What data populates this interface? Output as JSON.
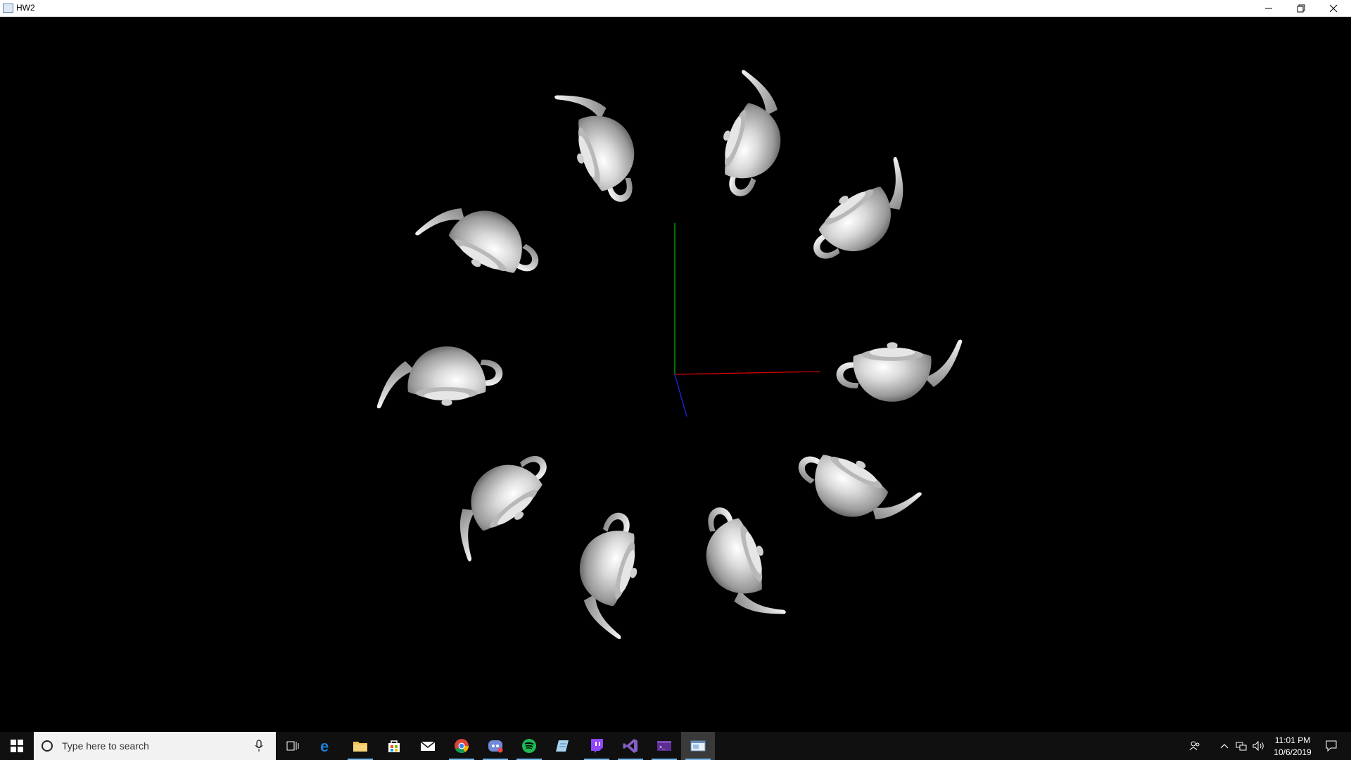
{
  "window": {
    "title": "HW2"
  },
  "colors": {
    "axis_x": "#e00000",
    "axis_y": "#00c000",
    "axis_z": "#2020d0",
    "teapot_light": "#f4f4f4",
    "teapot_mid": "#bdbdbd",
    "teapot_dark": "#6a6a6a",
    "taskbar_bg": "#101010",
    "accent": "#76b9ed"
  },
  "scene": {
    "teapot_count": 10,
    "axes": [
      "x-axis",
      "y-axis",
      "z-axis"
    ]
  },
  "taskbar": {
    "search_placeholder": "Type here to search",
    "pinned_apps": [
      "task-view",
      "edge",
      "file-explorer",
      "store",
      "mail",
      "chrome",
      "discord",
      "spotify",
      "notepad-app",
      "twitch",
      "visual-studio",
      "terminal",
      "opengl-window"
    ],
    "clock_time": "11:01 PM",
    "clock_date": "10/6/2019"
  }
}
